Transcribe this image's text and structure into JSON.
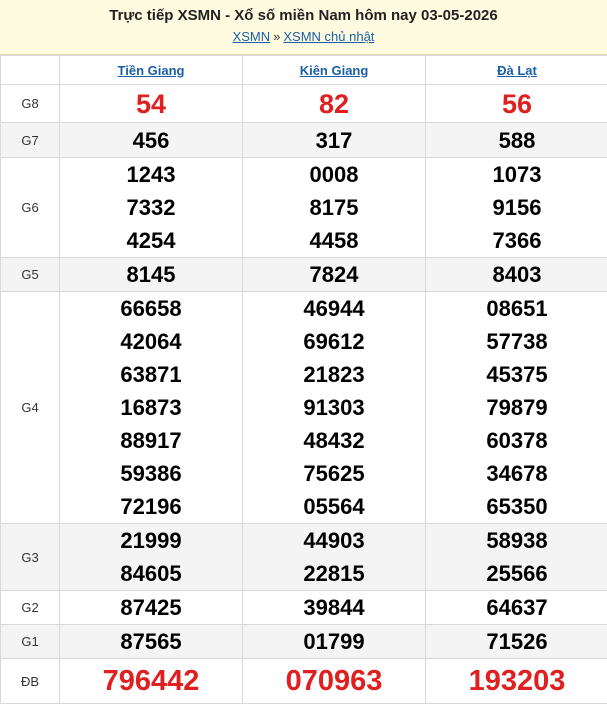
{
  "header": {
    "title": "Trực tiếp XSMN - Xổ số miền Nam hôm nay 03-05-2026",
    "crumb_1": "XSMN",
    "crumb_sep": "»",
    "crumb_2": "XSMN chủ nhật"
  },
  "provinces": [
    "Tiền Giang",
    "Kiên Giang",
    "Đà Lạt"
  ],
  "prizes": {
    "g8": {
      "label": "G8",
      "values": [
        [
          "54"
        ],
        [
          "82"
        ],
        [
          "56"
        ]
      ]
    },
    "g7": {
      "label": "G7",
      "values": [
        [
          "456"
        ],
        [
          "317"
        ],
        [
          "588"
        ]
      ]
    },
    "g6": {
      "label": "G6",
      "values": [
        [
          "1243",
          "7332",
          "4254"
        ],
        [
          "0008",
          "8175",
          "4458"
        ],
        [
          "1073",
          "9156",
          "7366"
        ]
      ]
    },
    "g5": {
      "label": "G5",
      "values": [
        [
          "8145"
        ],
        [
          "7824"
        ],
        [
          "8403"
        ]
      ]
    },
    "g4": {
      "label": "G4",
      "values": [
        [
          "66658",
          "42064",
          "63871",
          "16873",
          "88917",
          "59386",
          "72196"
        ],
        [
          "46944",
          "69612",
          "21823",
          "91303",
          "48432",
          "75625",
          "05564"
        ],
        [
          "08651",
          "57738",
          "45375",
          "79879",
          "60378",
          "34678",
          "65350"
        ]
      ]
    },
    "g3": {
      "label": "G3",
      "values": [
        [
          "21999",
          "84605"
        ],
        [
          "44903",
          "22815"
        ],
        [
          "58938",
          "25566"
        ]
      ]
    },
    "g2": {
      "label": "G2",
      "values": [
        [
          "87425"
        ],
        [
          "39844"
        ],
        [
          "64637"
        ]
      ]
    },
    "g1": {
      "label": "G1",
      "values": [
        [
          "87565"
        ],
        [
          "01799"
        ],
        [
          "71526"
        ]
      ]
    },
    "db": {
      "label": "ĐB",
      "values": [
        [
          "796442"
        ],
        [
          "070963"
        ],
        [
          "193203"
        ]
      ]
    }
  },
  "colors": {
    "accent_red": "#e02020",
    "link_blue": "#1a5fa8",
    "header_bg": "#fffbe0",
    "alt_row_bg": "#f4f4f4"
  }
}
